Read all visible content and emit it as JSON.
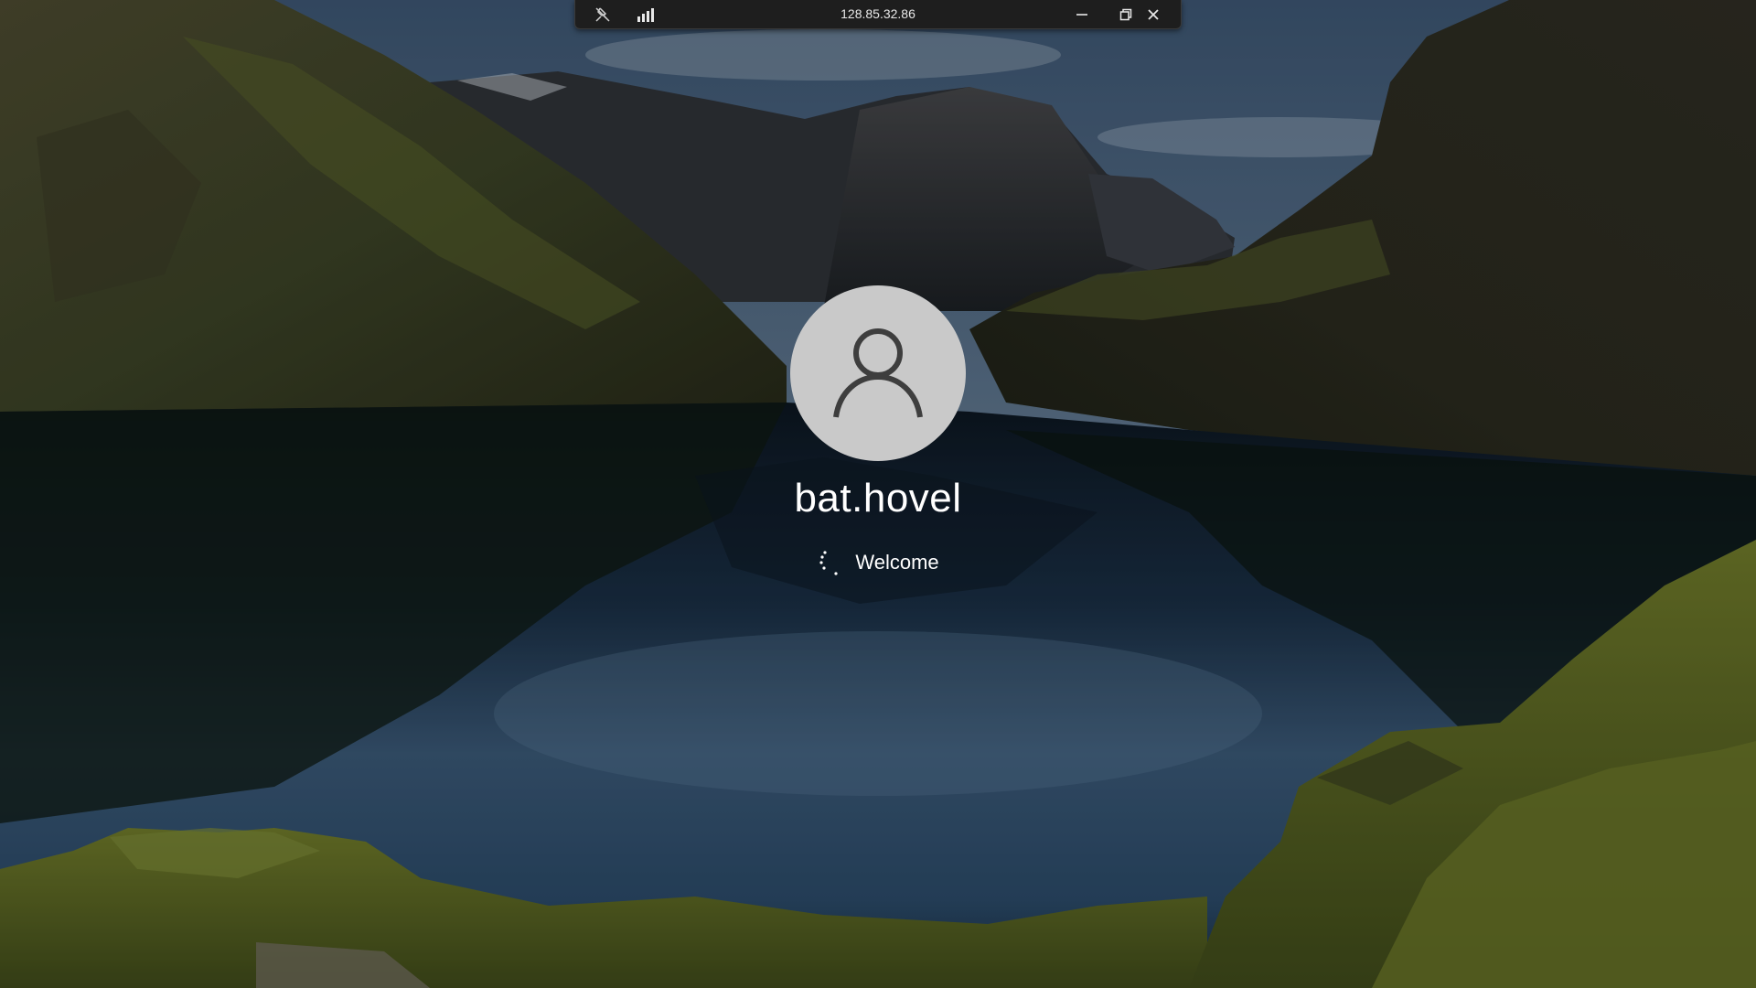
{
  "remote_bar": {
    "title": "128.85.32.86",
    "icons": {
      "unpin": "pin-off-icon",
      "connection": "signal-bars-icon",
      "minimize": "minimize-icon",
      "restore": "restore-icon",
      "close": "close-icon"
    }
  },
  "login": {
    "avatar_icon": "user-icon",
    "username": "bat.hovel",
    "status_text": "Welcome",
    "spinner_icon": "loading-spinner-icon"
  },
  "colors": {
    "bar_bg": "#1e1e1e",
    "avatar_bg": "#c9c9c9",
    "avatar_glyph": "#3e3e3e",
    "text": "#ffffff"
  }
}
